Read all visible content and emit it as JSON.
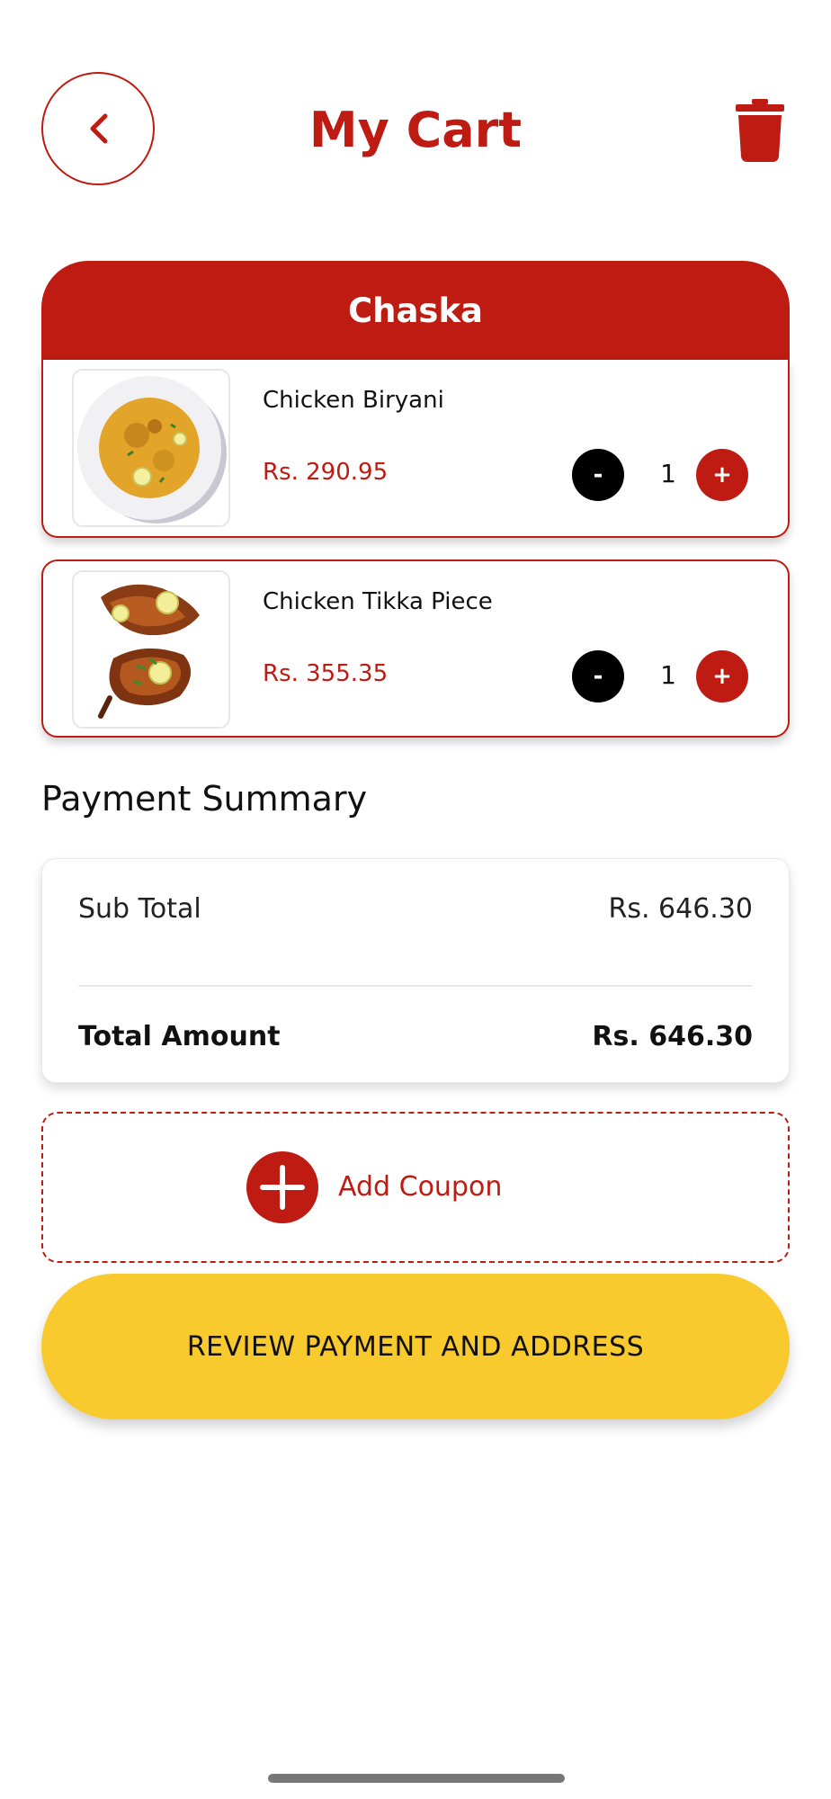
{
  "header": {
    "title": "My Cart",
    "back_icon": "chevron-left-icon",
    "delete_icon": "trash-icon"
  },
  "restaurant": {
    "name": "Chaska"
  },
  "items": [
    {
      "name": "Chicken Biryani",
      "price": "Rs. 290.95",
      "quantity": "1",
      "image": "biryani-plate"
    },
    {
      "name": "Chicken Tikka Piece",
      "price": "Rs. 355.35",
      "quantity": "1",
      "image": "tikka-pieces"
    }
  ],
  "qty_controls": {
    "minus": "-",
    "plus": "+"
  },
  "payment_summary": {
    "title": "Payment Summary",
    "subtotal_label": "Sub Total",
    "subtotal_value": "Rs. 646.30",
    "total_label": "Total Amount",
    "total_value": "Rs. 646.30"
  },
  "coupon": {
    "label": "Add Coupon",
    "icon": "plus-circle-icon"
  },
  "cta": {
    "label": "REVIEW PAYMENT AND ADDRESS"
  },
  "colors": {
    "brand_red": "#be1b12",
    "cta_yellow": "#f8ca2e",
    "minus_black": "#000000"
  }
}
